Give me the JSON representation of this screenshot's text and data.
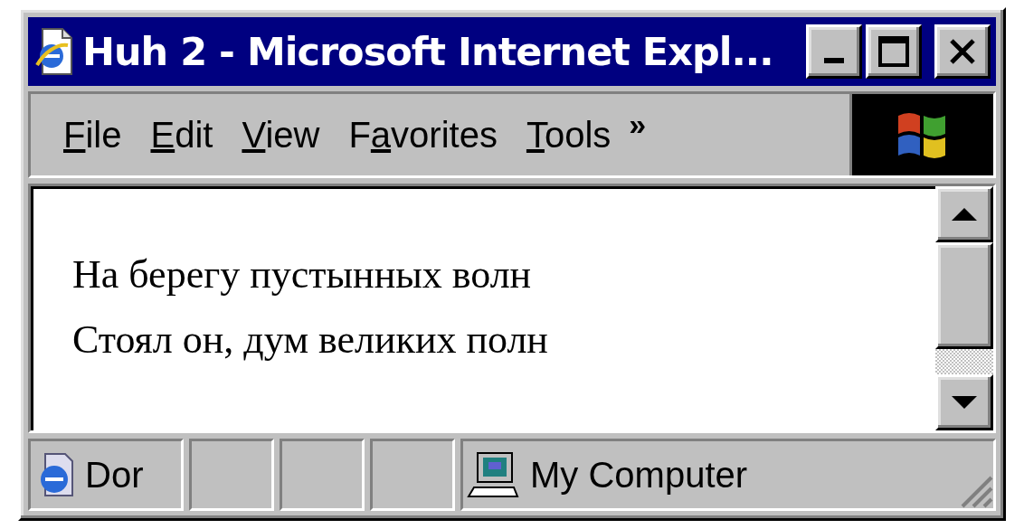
{
  "window": {
    "title": "Huh 2 - Microsoft Internet Expl..."
  },
  "menu": [
    {
      "key": "F",
      "post": "ile"
    },
    {
      "key": "E",
      "post": "dit"
    },
    {
      "key": "V",
      "post": "iew"
    },
    {
      "pre": "F",
      "key": "a",
      "post": "vorites"
    },
    {
      "key": "T",
      "post": "ools"
    }
  ],
  "menu_overflow": "»",
  "content": {
    "lines": [
      "На берегу пустынных волн",
      "Стоял он, дум великих полн"
    ]
  },
  "status_bar": {
    "panes": [
      {
        "kind": "status",
        "text": "Dor"
      },
      {
        "kind": "empty"
      },
      {
        "kind": "empty"
      },
      {
        "kind": "empty"
      },
      {
        "kind": "zone",
        "text": "My Computer"
      }
    ]
  }
}
